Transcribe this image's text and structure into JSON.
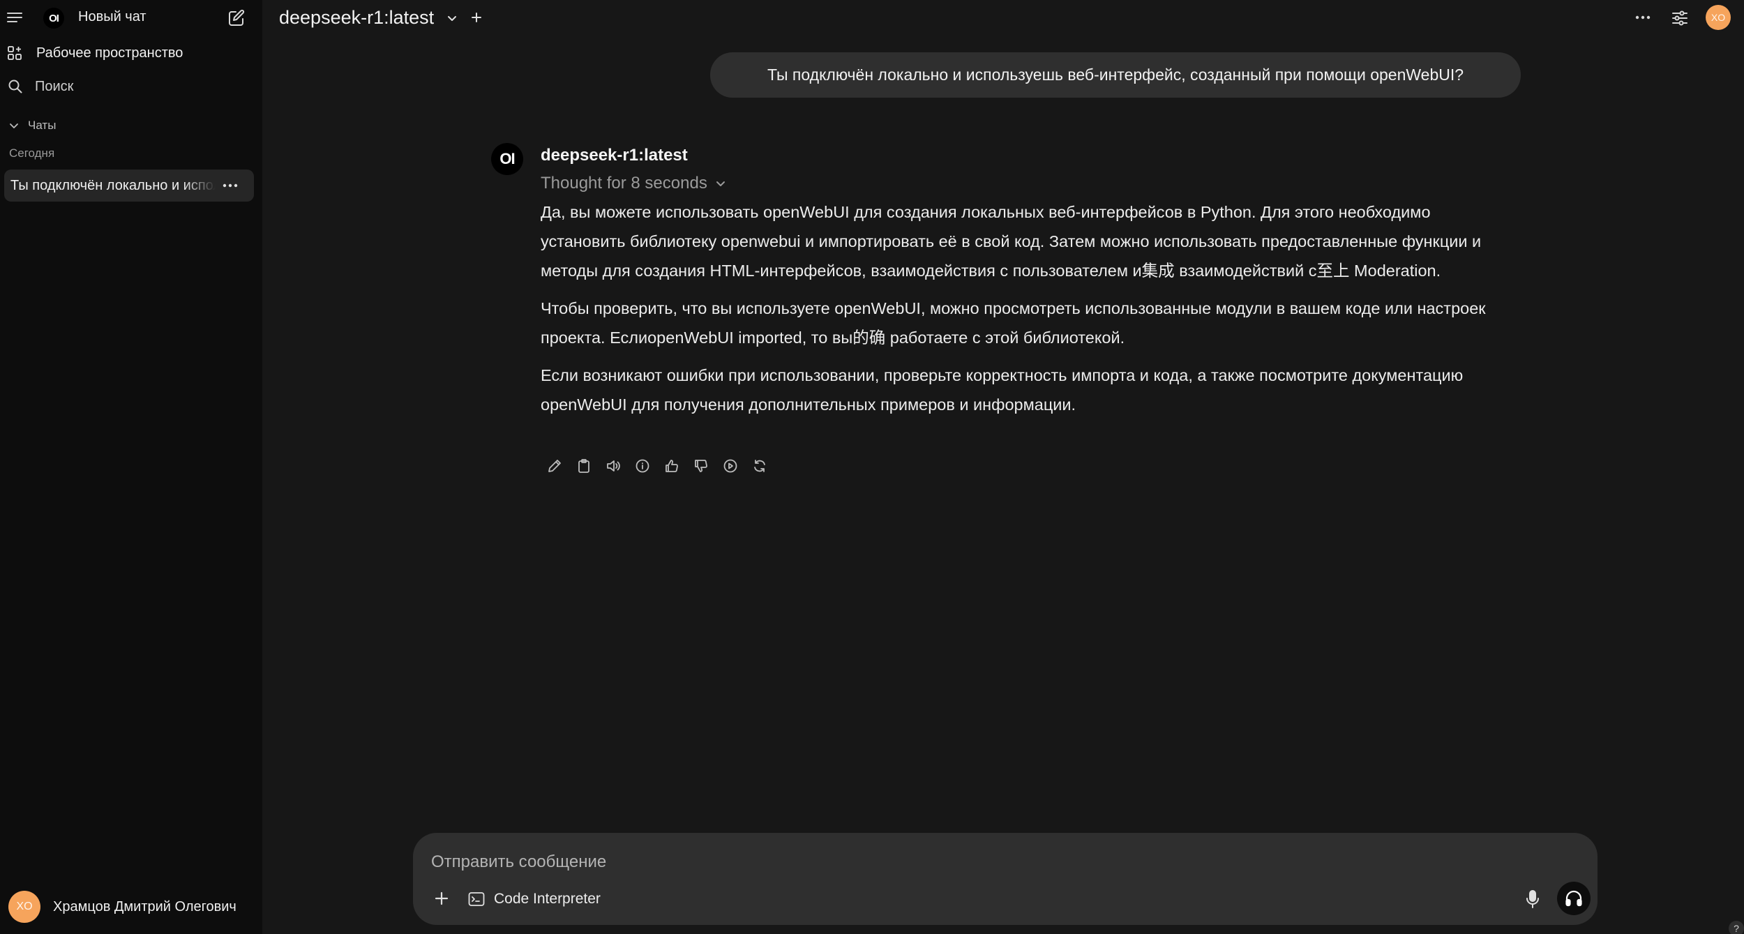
{
  "sidebar": {
    "app_title": "Новый чат",
    "logo_text": "OI",
    "workspace_label": "Рабочее пространство",
    "search_label": "Поиск",
    "chats_section": "Чаты",
    "date_group": "Сегодня",
    "chats": [
      {
        "title": "Ты подключён локально и используешь веб-интерфейс, созданный при помощи openWebUI?"
      }
    ],
    "user": {
      "initials": "XO",
      "name": "Храмцов Дмитрий Олегович"
    }
  },
  "header": {
    "model": "deepseek-r1:latest",
    "avatar_initials": "XO"
  },
  "conversation": {
    "user_message": "Ты подключён локально и используешь веб-интерфейс, созданный при помощи openWebUI?",
    "assistant": {
      "avatar_text": "OI",
      "name": "deepseek-r1:latest",
      "thought_label": "Thought for 8 seconds",
      "paragraphs": [
        "Да, вы можете использовать openWebUI для создания локальных веб-интерфейсов в Python. Для этого необходимо установить библиотеку openwebui и импортировать её в свой код. Затем можно использовать предоставленные функции и методы для создания HTML-интерфейсов, взаимодействия с пользователем и集成 взаимодействий с至上 Moderation.",
        "Чтобы проверить, что вы используете openWebUI, можно просмотреть использованные модули в вашем коде или настроек проекта. ЕслиopenWebUI imported, то вы的确 работаете с этой библиотекой.",
        "Если возникают ошибки при использовании, проверьте корректность импорта и кода, а также посмотрите документацию openWebUI для получения дополнительных примеров и информации."
      ],
      "actions": [
        "edit-icon",
        "copy-icon",
        "read-aloud-icon",
        "info-icon",
        "thumbs-up-icon",
        "thumbs-down-icon",
        "continue-icon",
        "regenerate-icon"
      ]
    }
  },
  "composer": {
    "placeholder": "Отправить сообщение",
    "code_interpreter_label": "Code Interpreter"
  },
  "help_label": "?",
  "colors": {
    "avatar": "#f6a45c",
    "background": "#171717",
    "sidebar": "#0d0d0d",
    "bubble": "#2f2f2f"
  }
}
